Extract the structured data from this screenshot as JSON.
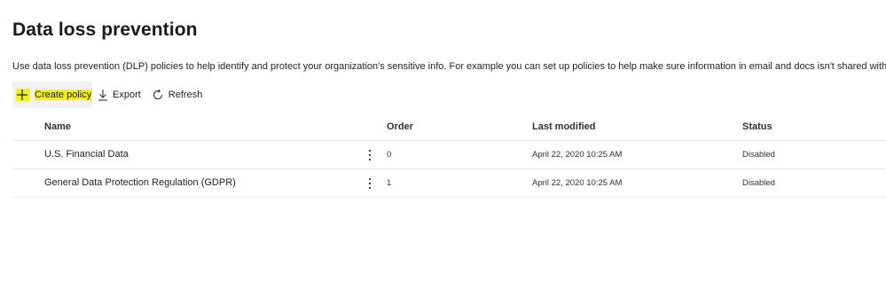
{
  "page": {
    "title": "Data loss prevention",
    "description": "Use data loss prevention (DLP) policies to help identify and protect your organization's sensitive info. For example you can set up policies to help make sure information in email and docs isn't shared with the wrong pe"
  },
  "toolbar": {
    "create_label": "Create policy",
    "create_icon": "plus-icon",
    "export_label": "Export",
    "export_icon": "download-icon",
    "refresh_label": "Refresh",
    "refresh_icon": "refresh-icon",
    "highlight_color": "#f2f21e"
  },
  "table": {
    "columns": [
      "Name",
      "Order",
      "Last modified",
      "Status"
    ],
    "rows": [
      {
        "name": "U.S. Financial Data",
        "order": "0",
        "last_modified": "April 22, 2020 10:25 AM",
        "status": "Disabled"
      },
      {
        "name": "General Data Protection Regulation (GDPR)",
        "order": "1",
        "last_modified": "April 22, 2020 10:25 AM",
        "status": "Disabled"
      }
    ]
  }
}
